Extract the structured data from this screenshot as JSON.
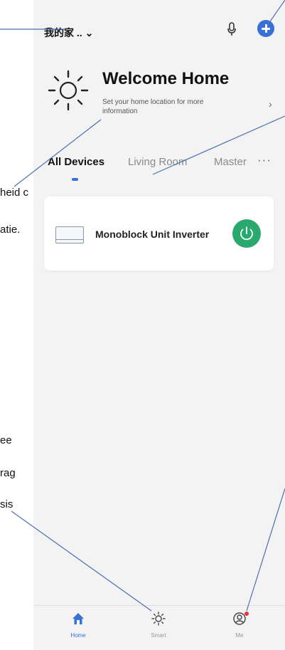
{
  "header": {
    "home_name": "我的家 ..",
    "chevron_glyph": "⌄",
    "mic_icon": "microphone-icon",
    "add_icon": "plus-circle-icon",
    "accent_color": "#3a6fd8"
  },
  "welcome": {
    "title": "Welcome Home",
    "subtitle": "Set your home location for more information",
    "arrow": "›",
    "weather_icon": "sun-icon"
  },
  "tabs": {
    "items": [
      {
        "label": "All Devices",
        "active": true
      },
      {
        "label": "Living Room",
        "active": false
      },
      {
        "label": "Master",
        "active": false
      }
    ],
    "more": "···"
  },
  "devices": [
    {
      "name": "Monoblock Unit Inverter",
      "icon": "air-conditioner-icon",
      "power_icon": "power-icon",
      "power_color": "#2aa96f"
    }
  ],
  "bottom_nav": [
    {
      "label": "Home",
      "icon": "home-icon",
      "active": true
    },
    {
      "label": "Smart",
      "icon": "smart-sun-icon",
      "active": false
    },
    {
      "label": "Me",
      "icon": "profile-icon",
      "active": false,
      "badge": true
    }
  ],
  "side_fragments": [
    "heid c",
    "atie.",
    "ee",
    "rag",
    "sis"
  ]
}
